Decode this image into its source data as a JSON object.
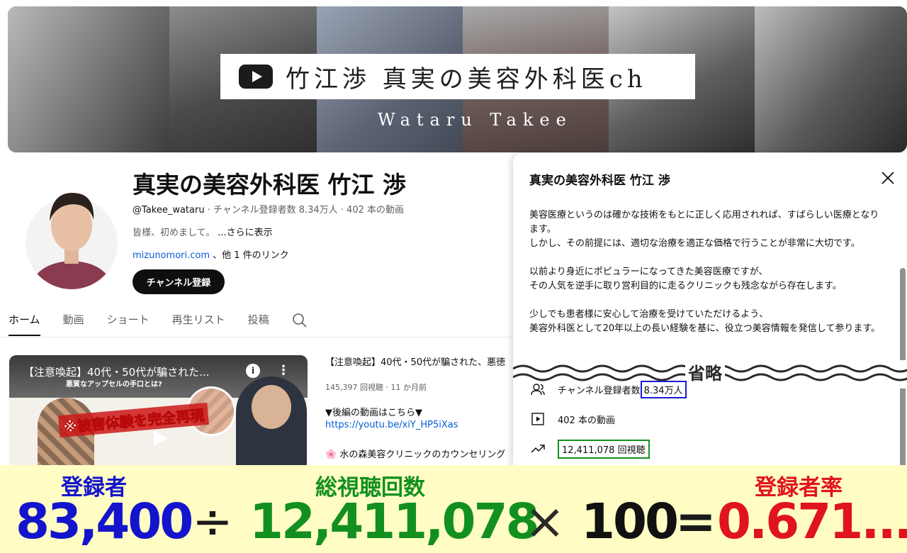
{
  "banner": {
    "title": "竹江渉 真実の美容外科医ch",
    "subtitle": "Wataru Takee"
  },
  "channel": {
    "name": "真実の美容外科医 竹江 渉",
    "handle": "@Takee_wataru",
    "meta_rest": " · チャンネル登録者数 8.34万人 · 402 本の動画",
    "description": "皆様、初めまして。",
    "more": "...さらに表示",
    "link_url": "mizunomori.com",
    "link_rest": " 、他 1 件のリンク",
    "subscribe_label": "チャンネル登録"
  },
  "tabs": [
    {
      "label": "ホーム"
    },
    {
      "label": "動画"
    },
    {
      "label": "ショート"
    },
    {
      "label": "再生リスト"
    },
    {
      "label": "投稿"
    }
  ],
  "video": {
    "thumb_title": "【注意喚起】40代・50代が騙された...",
    "thumb_sub": "悪質なアップセルの手口とは?",
    "thumb_overlay": "※被害体験を完全再現",
    "title": "【注意喚起】40代・50代が騙された、悪徳",
    "meta": "145,397 回視聴 · 11 か月前",
    "desc_line1": "▼後編の動画はこちら▼",
    "desc_link": "https://youtu.be/xiY_HP5iXas",
    "desc_line2": "🌸 水の森美容クリニックのカウンセリング"
  },
  "about": {
    "title": "真実の美容外科医 竹江 渉",
    "paragraphs": [
      "美容医療というのは確かな技術をもとに正しく応用されれば、すばらしい医療となります。\nしかし、その前提には、適切な治療を適正な価格で行うことが非常に大切です。",
      "以前より身近にポピュラーになってきた美容医療ですが、\nその人気を逆手に取り営利目的に走るクリニックも残念ながら存在します。",
      "少しでも患者様に安心して治療を受けていただけるよう、\n美容外科医として20年以上の長い経験を基に、役立つ美容情報を発信して参ります。"
    ],
    "omitted_label": "省略",
    "subscribers_label": "チャンネル登録者数",
    "subscribers_value": "8.34万人",
    "videos_label": "402 本の動画",
    "views_label": "12,411,078 回視聴"
  },
  "formula": {
    "subscribers_label": "登録者",
    "subscribers_value": "83,400",
    "divide": "÷",
    "views_label": "総視聴回数",
    "views_value": "12,411,078",
    "times": "×",
    "multiplier": "100",
    "equals": "=",
    "rate_label": "登録者率",
    "rate_value": "0.671..."
  },
  "colors": {
    "blue": "#1414cc",
    "green": "#12901f",
    "red": "#e0141e",
    "formula_bg": "#fffdc4"
  }
}
